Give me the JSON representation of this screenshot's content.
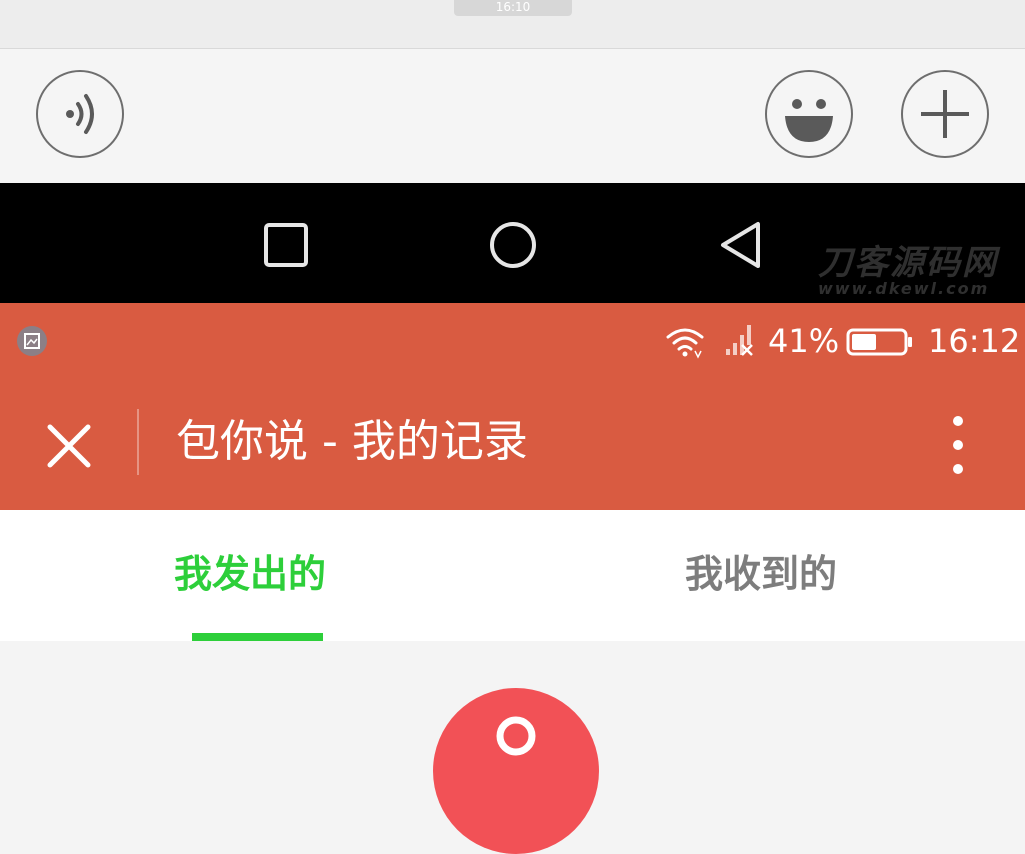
{
  "chat": {
    "time_chip": "16:10"
  },
  "status_bar": {
    "battery": "41%",
    "time": "16:12"
  },
  "app_bar": {
    "title": "包你说 - 我的记录"
  },
  "tabs": [
    {
      "label": "我发出的",
      "active": true
    },
    {
      "label": "我收到的",
      "active": false
    }
  ],
  "watermark": {
    "cn": "刀客源码网",
    "en": "www.dkewl.com"
  },
  "colors": {
    "accent": "#2dcf3a",
    "app_bar": "#d95b41",
    "red_button": "#f25156"
  }
}
